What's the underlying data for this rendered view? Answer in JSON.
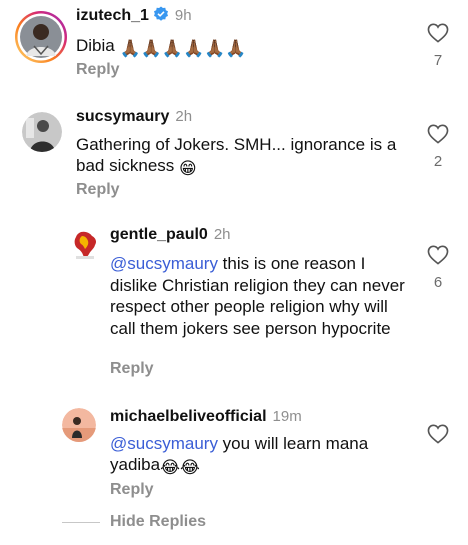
{
  "comments": [
    {
      "username": "izutech_1",
      "verified": true,
      "time": "9h",
      "text": "Dibia",
      "emojis": "🙏🏾🙏🏾🙏🏾🙏🏾🙏🏾🙏🏾",
      "reply_label": "Reply",
      "likes": "7"
    },
    {
      "username": "sucsymaury",
      "time": "2h",
      "text": "Gathering of Jokers. SMH... ignorance is a bad sickness",
      "emojis": "😁",
      "reply_label": "Reply",
      "likes": "2"
    },
    {
      "username": "gentle_paul0",
      "time": "2h",
      "mention": "@sucsymaury",
      "text": " this is one reason I dislike Christian religion they can never respect other people religion why will call them jokers see person hypocrite",
      "reply_label": "Reply",
      "likes": "6"
    },
    {
      "username": "michaelbeliveofficial",
      "time": "19m",
      "mention": "@sucsymaury",
      "text": " you will learn mana yadiba",
      "emojis": "😂😂",
      "reply_label": "Reply",
      "likes": ""
    }
  ],
  "hide_replies_label": "Hide Replies",
  "colors": {
    "mention": "#3b5ed6",
    "muted": "#8e8e8e",
    "verified": "#3897f0",
    "story_ring": "#d6249f"
  },
  "icons": {
    "like": "heart-outline-icon",
    "verified": "verified-badge-icon"
  }
}
